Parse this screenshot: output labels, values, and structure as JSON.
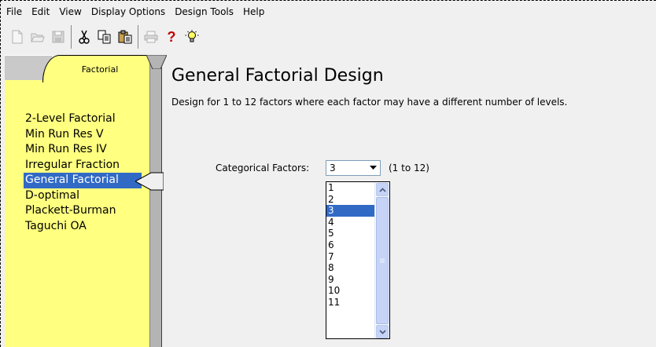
{
  "menu": {
    "items": [
      "File",
      "Edit",
      "View",
      "Display Options",
      "Design Tools",
      "Help"
    ]
  },
  "toolbar": {
    "buttons": [
      "new-file",
      "open-folder",
      "save",
      "cut",
      "copy",
      "paste",
      "print",
      "help",
      "tip"
    ]
  },
  "sidebar": {
    "tab_label": "Factorial",
    "items": [
      {
        "label": "2-Level Factorial",
        "selected": false
      },
      {
        "label": "Min Run Res V",
        "selected": false
      },
      {
        "label": "Min Run Res IV",
        "selected": false
      },
      {
        "label": "Irregular Fraction",
        "selected": false
      },
      {
        "label": "General Factorial",
        "selected": true
      },
      {
        "label": "D-optimal",
        "selected": false
      },
      {
        "label": "Plackett-Burman",
        "selected": false
      },
      {
        "label": "Taguchi OA",
        "selected": false
      }
    ]
  },
  "main": {
    "title": "General Factorial Design",
    "description": "Design for 1 to 12 factors where each factor may have a different number of levels.",
    "categorical_label": "Categorical Factors:",
    "categorical_value": "3",
    "range_note": "(1 to 12)",
    "dropdown_options": [
      "1",
      "2",
      "3",
      "4",
      "5",
      "6",
      "7",
      "8",
      "9",
      "10",
      "11"
    ],
    "dropdown_selected": "3"
  },
  "colors": {
    "sidebar_bg": "#ffff80",
    "selection": "#316ac5"
  }
}
